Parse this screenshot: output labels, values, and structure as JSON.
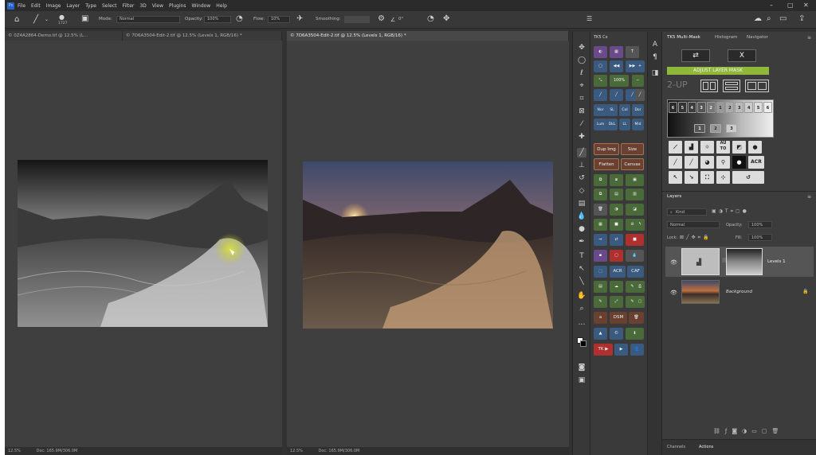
{
  "menubar": {
    "logo": "Ps",
    "items": [
      "File",
      "Edit",
      "Image",
      "Layer",
      "Type",
      "Select",
      "Filter",
      "3D",
      "View",
      "Plugins",
      "Window",
      "Help"
    ],
    "window_controls": [
      "–",
      "▢",
      "✕"
    ]
  },
  "options": {
    "brush_size": "1727",
    "mode_label": "Mode:",
    "mode_value": "Normal",
    "opacity_label": "Opacity:",
    "opacity_value": "100%",
    "flow_label": "Flow:",
    "flow_value": "10%",
    "smoothing_label": "Smoothing:",
    "angle_value": "0°"
  },
  "documents": {
    "left_tabs": [
      "© 0Z4A2864-Demo.tif @ 12.5% (L...",
      "© 7D6A3504-Edit-2.tif @ 12.5% (Levels 1, RGB/16) *"
    ],
    "right_tab": "© 7D6A3504-Edit-2.tif @ 12.5% (Levels 1, RGB/16) *",
    "left_zoom": "12.5%",
    "left_doc_info": "Doc: 165.9M/306.0M",
    "right_zoom": "12.5%",
    "right_doc_info": "Doc: 165.9M/306.0M"
  },
  "tk_panel": {
    "title": "TK5 Cx",
    "zoom": "100%",
    "row_nor": [
      "Nor",
      "SL",
      "Col",
      "Dor"
    ],
    "row_lum": [
      "Lum",
      "DkL",
      "LL",
      "Mid"
    ],
    "dup_img": "Dup Img",
    "size": "Size",
    "flatten": "Flatten",
    "canvas": "Canvas",
    "acr": "ACR",
    "caf": "CAF",
    "dsm": "DSM",
    "tk": "TK"
  },
  "right_panel": {
    "tabs": [
      "TK5 Multi-Mask",
      "Histogram",
      "Navigator"
    ],
    "adjust_label": "ADJUST LAYER MASK",
    "two_up": "2-UP",
    "grid_top": [
      "6",
      "5",
      "4",
      "3",
      "2",
      "1",
      "2",
      "3",
      "4",
      "5",
      "6"
    ],
    "grid_mid": [
      "1",
      "2",
      "3"
    ],
    "acr": "ACR",
    "layers_title": "Layers",
    "kind_label": "Kind",
    "blend_mode": "Normal",
    "opacity_label": "Opacity:",
    "opacity_value": "100%",
    "lock_label": "Lock:",
    "fill_label": "Fill:",
    "fill_value": "100%",
    "layer1_name": "Levels 1",
    "layer2_name": "Background",
    "bottom_tabs": [
      "Channels",
      "Actions"
    ]
  },
  "colors": {
    "app_bg": "#323232",
    "accent_green": "#8fb83a",
    "tk_purple": "#6a4a8a",
    "tk_green": "#4a6a3a",
    "tk_blue": "#3a5a80",
    "tk_red": "#b03030",
    "tk_brown": "#6a4030"
  }
}
